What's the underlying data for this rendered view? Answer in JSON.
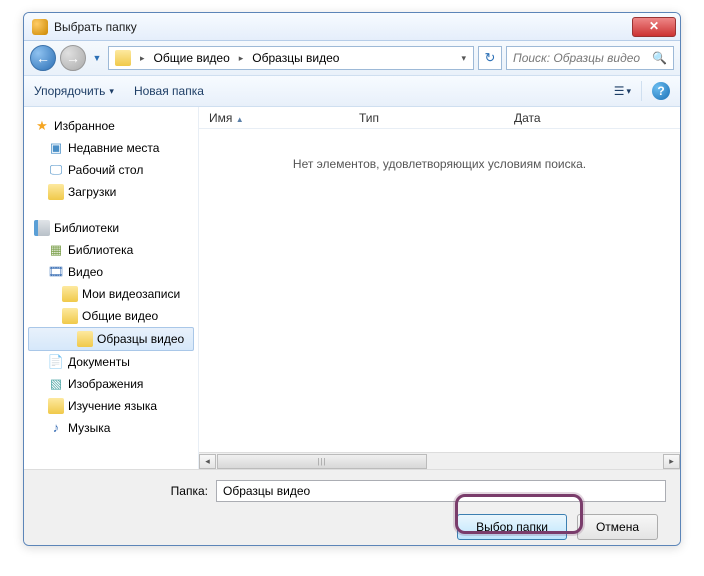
{
  "window": {
    "title": "Выбрать папку"
  },
  "address": {
    "segments": [
      "Общие видео",
      "Образцы видео"
    ],
    "refresh_hint": "↻"
  },
  "search": {
    "placeholder": "Поиск: Образцы видео"
  },
  "toolbar": {
    "organize": "Упорядочить",
    "new_folder": "Новая папка"
  },
  "tree": {
    "favorites": "Избранное",
    "recent": "Недавние места",
    "desktop": "Рабочий стол",
    "downloads": "Загрузки",
    "libraries": "Библиотеки",
    "lib_items": {
      "biblioteka": "Библиотека",
      "video": "Видео",
      "my_video": "Мои видеозаписи",
      "common_video": "Общие видео",
      "samples_video": "Образцы видео",
      "documents": "Документы",
      "images": "Изображения",
      "study": "Изучение языка",
      "music": "Музыка"
    }
  },
  "columns": {
    "name": "Имя",
    "type": "Тип",
    "date": "Дата"
  },
  "content": {
    "empty_msg": "Нет элементов, удовлетворяющих условиям поиска."
  },
  "footer": {
    "folder_label": "Папка:",
    "folder_value": "Образцы видео",
    "select_btn": "Выбор папки",
    "cancel_btn": "Отмена"
  }
}
